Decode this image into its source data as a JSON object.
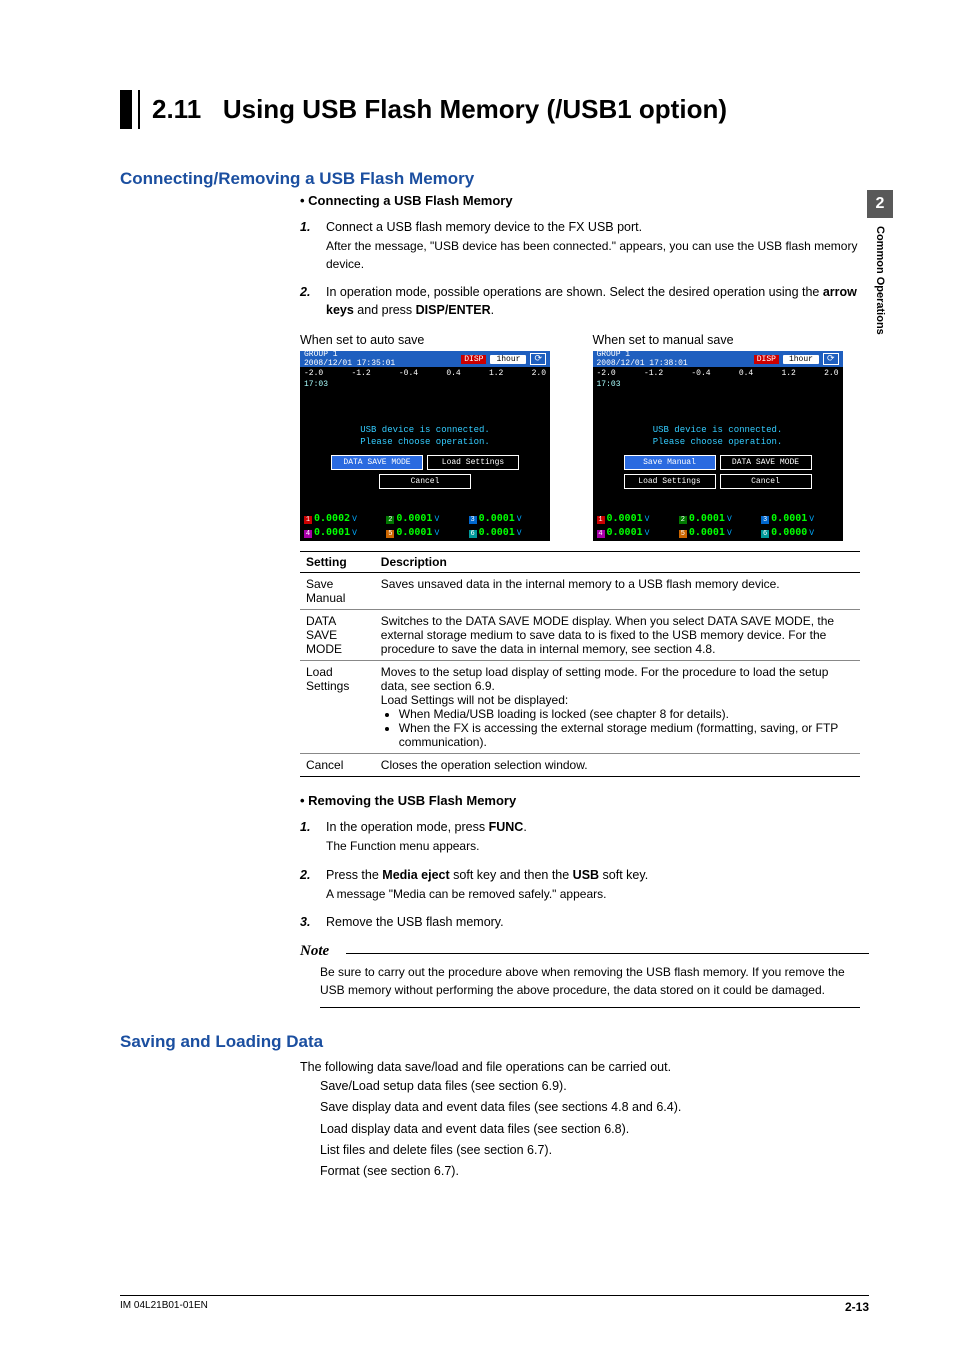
{
  "sidebar": {
    "chapter_num": "2",
    "chapter_label": "Common Operations"
  },
  "title": {
    "number": "2.11",
    "text": "Using USB Flash Memory (/USB1 option)"
  },
  "section1": {
    "heading": "Connecting/Removing a USB Flash Memory",
    "connecting": {
      "subheading": "Connecting a USB Flash Memory",
      "step1_num": "1.",
      "step1_main": "Connect a USB flash memory device to the FX USB port.",
      "step1_after": "After the message, \"USB device has been connected.\" appears, you can use the USB flash memory device.",
      "step2_num": "2.",
      "step2_main_a": "In operation mode, possible operations are shown. Select the desired operation using the ",
      "step2_bold1": "arrow keys",
      "step2_mid": " and press ",
      "step2_bold2": "DISP/ENTER",
      "step2_end": "."
    },
    "screens": {
      "left_label": "When set to auto save",
      "right_label": "When set to manual save",
      "group": "GROUP 1",
      "ts_left": "2008/12/01 17:35:01",
      "ts_right": "2008/12/01 17:38:01",
      "disp_label": "DISP",
      "time_span": "1hour",
      "scale": [
        "-2.0",
        "-1.2",
        "-0.4",
        "0.4",
        "1.2",
        "2.0"
      ],
      "clock": "17:03",
      "dialog1": "USB device is connected.",
      "dialog2": "Please choose operation.",
      "btn_data_save": "DATA SAVE MODE",
      "btn_load": "Load Settings",
      "btn_cancel": "Cancel",
      "btn_save_manual": "Save Manual",
      "values": [
        "0.0002",
        "0.0001",
        "0.0001",
        "0.0001",
        "0.0001",
        "0.0001"
      ],
      "values_r": [
        "0.0001",
        "0.0001",
        "0.0001",
        "0.0001",
        "0.0001",
        "0.0000"
      ],
      "unit": "V"
    },
    "table": {
      "h1": "Setting",
      "h2": "Description",
      "r1_s": "Save Manual",
      "r1_d": "Saves unsaved data in the internal memory to a USB flash memory device.",
      "r2_s": "DATA SAVE MODE",
      "r2_d": "Switches to the DATA SAVE MODE display. When you select DATA SAVE MODE, the external storage medium to save data to is fixed to the USB memory device. For the procedure to save the data in internal memory, see section 4.8.",
      "r3_s": "Load Settings",
      "r3_d_a": "Moves to the setup load display of setting mode. For the procedure to load the setup data, see section 6.9.",
      "r3_d_b": "Load Settings will not be displayed:",
      "r3_li1": "When Media/USB loading is locked (see chapter 8 for details).",
      "r3_li2": "When the FX is accessing the external storage medium (formatting, saving, or FTP communication).",
      "r4_s": "Cancel",
      "r4_d": "Closes the operation selection window."
    },
    "removing": {
      "subheading": "Removing the USB Flash Memory",
      "step1_num": "1.",
      "step1_a": "In the operation mode, press ",
      "step1_bold": "FUNC",
      "step1_b": ".",
      "step1_after": "The Function menu appears.",
      "step2_num": "2.",
      "step2_a": "Press the ",
      "step2_b1": "Media eject",
      "step2_mid": " soft key and then the ",
      "step2_b2": "USB",
      "step2_end": " soft key.",
      "step2_after": "A message \"Media can be removed safely.\" appears.",
      "step3_num": "3.",
      "step3_text": "Remove the USB flash memory."
    },
    "note": {
      "label": "Note",
      "text": "Be sure to carry out the procedure above when removing the USB flash memory. If you remove the USB memory without performing the above procedure, the data stored on it could be damaged."
    }
  },
  "section2": {
    "heading": "Saving and Loading Data",
    "intro": "The following data save/load and file operations can be carried out.",
    "items": [
      "Save/Load setup data files (see section 6.9).",
      "Save display data and event data files (see sections 4.8 and 6.4).",
      "Load display data and event data files (see section 6.8).",
      "List files and delete files (see section 6.7).",
      "Format (see section 6.7)."
    ]
  },
  "footer": {
    "doc_id": "IM 04L21B01-01EN",
    "page": "2-13"
  }
}
